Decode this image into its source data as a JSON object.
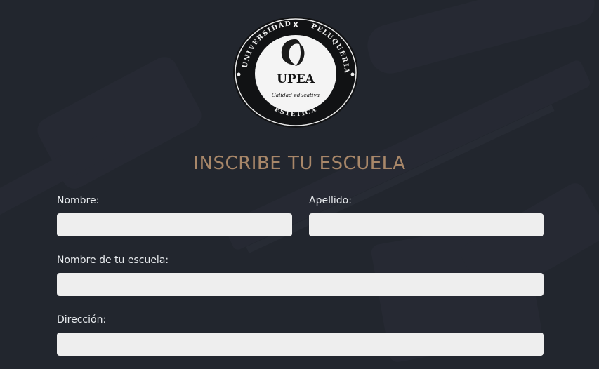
{
  "logo": {
    "ring_text_top_left": "UNIVERSIDAD",
    "ring_text_top_right": "PELUQUERIA",
    "ring_text_bottom": "ESTETICA",
    "ring_symbol": "X",
    "brand": "UPEA",
    "tagline": "Calidad educativa",
    "icon": "woman-silhouette-icon"
  },
  "form": {
    "title": "INSCRIBE TU ESCUELA",
    "fields": {
      "nombre": {
        "label": "Nombre:",
        "value": "",
        "placeholder": ""
      },
      "apellido": {
        "label": "Apellido:",
        "value": "",
        "placeholder": ""
      },
      "escuela": {
        "label": "Nombre de tu escuela:",
        "value": "",
        "placeholder": ""
      },
      "direccion": {
        "label": "Dirección:",
        "value": "",
        "placeholder": ""
      }
    }
  },
  "colors": {
    "background": "#22262e",
    "title": "#a88769",
    "input": "#eeeeee",
    "label": "#e9ecef"
  }
}
